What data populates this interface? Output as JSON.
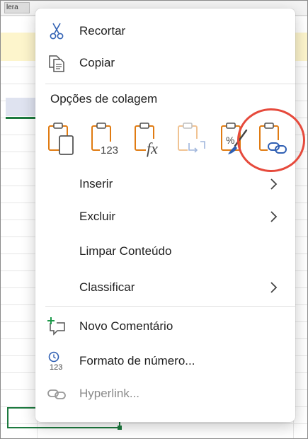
{
  "sheet": {
    "header_tab_text": "lera"
  },
  "menu": {
    "cut_label": "Recortar",
    "copy_label": "Copiar",
    "paste_options_title": "Opções de colagem",
    "paste_options": [
      {
        "icon": "paste-icon"
      },
      {
        "icon": "paste-values-icon",
        "text": "123"
      },
      {
        "icon": "paste-formulas-icon",
        "text": "fx"
      },
      {
        "icon": "paste-transpose-icon"
      },
      {
        "icon": "paste-formatting-icon",
        "text": "%"
      },
      {
        "icon": "paste-link-icon"
      }
    ],
    "insert_label": "Inserir",
    "delete_label": "Excluir",
    "clear_label": "Limpar Conteúdo",
    "sort_label": "Classificar",
    "new_comment_label": "Novo Comentário",
    "number_format_label": "Formato de número...",
    "hyperlink_label": "Hyperlink..."
  },
  "colors": {
    "accent_orange": "#e07b12",
    "icon_blue": "#2f5fb3",
    "highlight_red": "#e64a3c",
    "comment_green": "#1c9a4a"
  }
}
